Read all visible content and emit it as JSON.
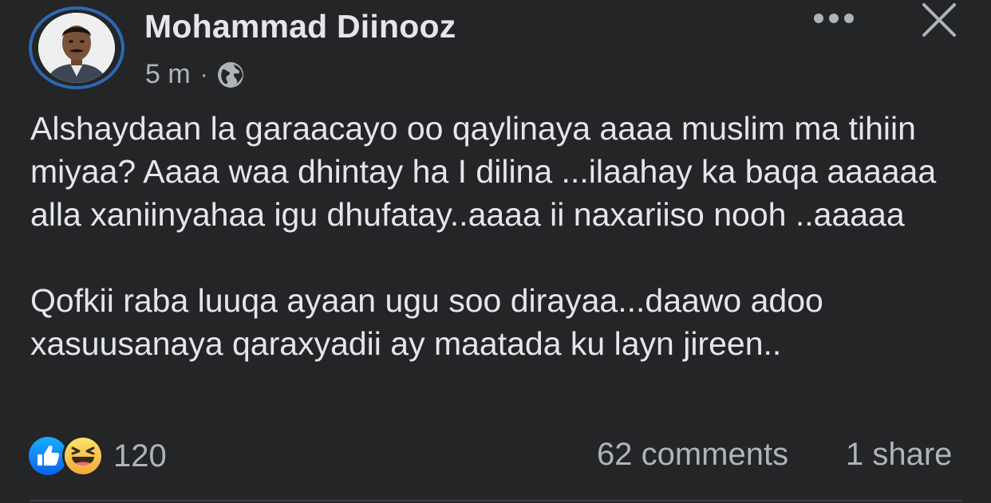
{
  "post": {
    "author_name": "Mohammad Diinooz",
    "timestamp": "5 m",
    "meta_separator": "·",
    "privacy_icon": "globe-icon",
    "text_paragraph_1": "Alshaydaan la garaacayo oo qaylinaya aaaa muslim ma tihiin miyaa? Aaaa waa dhintay ha I dilina ...ilaahay ka baqa aaaaaa alla xaniinyahaa igu dhufatay..aaaa ii naxariiso nooh ..aaaaa",
    "text_paragraph_2": "Qofkii raba luuqa ayaan ugu soo dirayaa...daawo adoo xasuusanaya qaraxyadii ay maatada ku layn jireen.."
  },
  "header_actions": {
    "more_icon": "more-dots-icon",
    "close_icon": "close-icon"
  },
  "engagement": {
    "reaction_icons": [
      "like-icon",
      "haha-icon"
    ],
    "reaction_count": "120",
    "comments": "62 comments",
    "shares": "1 share"
  },
  "colors": {
    "background": "#242526",
    "primary_text": "#e4e6eb",
    "secondary_text": "#b0b3b8",
    "avatar_ring": "#2d68b3",
    "like_blue": "#1877f2",
    "haha_yellow": "#f7c846"
  }
}
